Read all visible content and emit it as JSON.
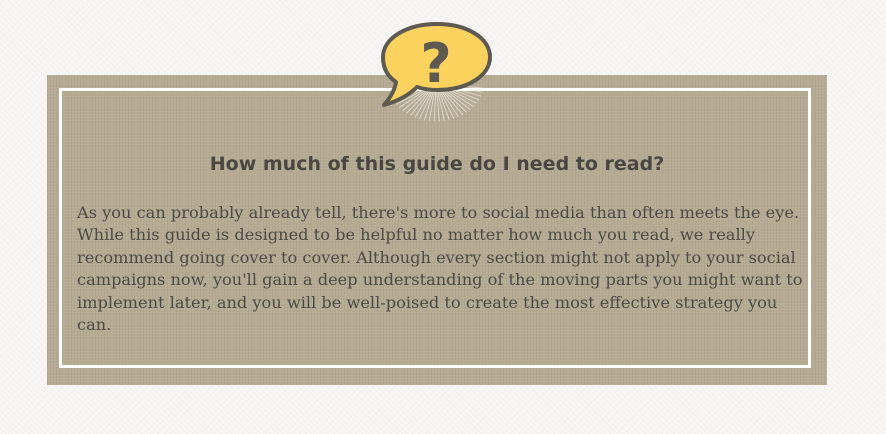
{
  "heading": "How much of this guide do I need to read?",
  "body": "As you can probably already tell, there's more to social media than often meets the eye. While this guide is designed to be helpful no matter how much you read, we really recommend going cover to cover. Although every section might not apply to your social campaigns now, you'll gain a deep understanding of the moving parts you might want to implement later, and you will be well-poised to create the most effective strategy you can.",
  "icon": {
    "name": "question-bubble-icon",
    "glyph": "?",
    "fill_color": "#fbd25e",
    "stroke_color": "#5e5a52"
  },
  "colors": {
    "card_background": "#b5aa93",
    "frame_border": "#ffffff",
    "text": "#4a4742",
    "page_background": "#f7f6f5"
  }
}
